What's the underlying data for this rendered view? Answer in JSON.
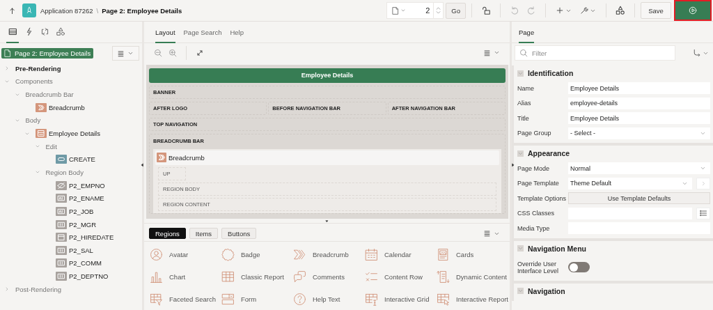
{
  "header": {
    "app": "Application 87262",
    "separator": "\\",
    "page": "Page 2: Employee Details"
  },
  "toolbar": {
    "page_number": "2",
    "go": "Go",
    "save": "Save",
    "undo": {
      "disabled": true
    },
    "redo": {
      "disabled": true
    },
    "run": {
      "outlined": true
    }
  },
  "left_panel": {
    "tabs": [
      {
        "kind": "rendering",
        "selected": true
      },
      {
        "kind": "dynamic-actions",
        "selected": false
      },
      {
        "kind": "processing",
        "selected": false
      },
      {
        "kind": "shared",
        "selected": false
      }
    ],
    "page_node": "Page 2: Employee Details",
    "tree": [
      {
        "label": "Pre-Rendering",
        "kind": "group",
        "emphasized": true,
        "expanded": false
      },
      {
        "label": "Components",
        "kind": "group",
        "emphasized": false,
        "expanded": true,
        "children": [
          {
            "label": "Breadcrumb Bar",
            "kind": "group",
            "emphasized": false,
            "expanded": true,
            "children": [
              {
                "label": "Breadcrumb",
                "kind": "breadcrumb"
              }
            ]
          },
          {
            "label": "Body",
            "kind": "group",
            "emphasized": false,
            "expanded": true,
            "children": [
              {
                "label": "Employee Details",
                "kind": "region",
                "expanded": true,
                "children": [
                  {
                    "label": "Edit",
                    "kind": "group",
                    "emphasized": false,
                    "expanded": true,
                    "children": [
                      {
                        "label": "CREATE",
                        "kind": "button"
                      }
                    ]
                  },
                  {
                    "label": "Region Body",
                    "kind": "group",
                    "emphasized": false,
                    "expanded": true,
                    "children": [
                      {
                        "label": "P2_EMPNO",
                        "kind": "hidden"
                      },
                      {
                        "label": "P2_ENAME",
                        "kind": "text"
                      },
                      {
                        "label": "P2_JOB",
                        "kind": "text"
                      },
                      {
                        "label": "P2_MGR",
                        "kind": "number"
                      },
                      {
                        "label": "P2_HIREDATE",
                        "kind": "date"
                      },
                      {
                        "label": "P2_SAL",
                        "kind": "number"
                      },
                      {
                        "label": "P2_COMM",
                        "kind": "number"
                      },
                      {
                        "label": "P2_DEPTNO",
                        "kind": "number"
                      }
                    ]
                  }
                ]
              }
            ]
          }
        ]
      },
      {
        "label": "Post-Rendering",
        "kind": "group",
        "emphasized": false,
        "expanded": false
      }
    ]
  },
  "center_panel": {
    "tabs": [
      {
        "label": "Layout",
        "selected": true
      },
      {
        "label": "Page Search",
        "selected": false
      },
      {
        "label": "Help",
        "selected": false
      }
    ],
    "canvas": {
      "title": "Employee Details",
      "rows": [
        [
          "BANNER"
        ],
        [
          "AFTER LOGO",
          "BEFORE NAVIGATION BAR",
          "AFTER NAVIGATION BAR"
        ],
        [
          "TOP NAVIGATION"
        ]
      ],
      "breadcrumb_bar": {
        "label": "BREADCRUMB BAR",
        "region": {
          "title": "Breadcrumb",
          "slots": [
            {
              "label": "UP",
              "kind": "inline"
            },
            {
              "label": "REGION BODY",
              "kind": "block"
            },
            {
              "label": "REGION CONTENT",
              "kind": "block"
            }
          ]
        }
      }
    },
    "gallery": {
      "tabs": [
        {
          "label": "Regions",
          "selected": true
        },
        {
          "label": "Items",
          "selected": false
        },
        {
          "label": "Buttons",
          "selected": false
        }
      ],
      "items": [
        {
          "label": "Avatar",
          "kind": "avatar"
        },
        {
          "label": "Badge",
          "kind": "badge"
        },
        {
          "label": "Breadcrumb",
          "kind": "breadcrumb"
        },
        {
          "label": "Calendar",
          "kind": "calendar"
        },
        {
          "label": "Cards",
          "kind": "cards"
        },
        {
          "label": "Chart",
          "kind": "chart"
        },
        {
          "label": "Classic Report",
          "kind": "table"
        },
        {
          "label": "Comments",
          "kind": "comments"
        },
        {
          "label": "Content Row",
          "kind": "content-row"
        },
        {
          "label": "Dynamic Content",
          "kind": "dynamic"
        },
        {
          "label": "Faceted Search",
          "kind": "faceted"
        },
        {
          "label": "Form",
          "kind": "form"
        },
        {
          "label": "Help Text",
          "kind": "help"
        },
        {
          "label": "Interactive Grid",
          "kind": "grid"
        },
        {
          "label": "Interactive Report",
          "kind": "report"
        }
      ]
    }
  },
  "right_panel": {
    "tabs": [
      {
        "label": "Page",
        "selected": true
      }
    ],
    "filter": {
      "placeholder": "Filter"
    },
    "sections": [
      {
        "title": "Identification",
        "expanded": true,
        "properties": [
          {
            "label": "Name",
            "kind": "text",
            "value": "Employee Details"
          },
          {
            "label": "Alias",
            "kind": "text",
            "value": "employee-details"
          },
          {
            "label": "Title",
            "kind": "text",
            "value": "Employee Details"
          },
          {
            "label": "Page Group",
            "kind": "select",
            "value": "- Select -"
          }
        ]
      },
      {
        "title": "Appearance",
        "expanded": true,
        "properties": [
          {
            "label": "Page Mode",
            "kind": "select",
            "value": "Normal"
          },
          {
            "label": "Page Template",
            "kind": "select-link",
            "value": "Theme Default"
          },
          {
            "label": "Template Options",
            "kind": "button",
            "value": "Use Template Defaults"
          },
          {
            "label": "CSS Classes",
            "kind": "text-list"
          },
          {
            "label": "Media Type",
            "kind": "text"
          }
        ]
      },
      {
        "title": "Navigation Menu",
        "expanded": true,
        "properties": [
          {
            "label": "Override User Interface Level",
            "kind": "toggle",
            "on": false
          }
        ]
      },
      {
        "title": "Navigation",
        "expanded": true
      }
    ]
  }
}
